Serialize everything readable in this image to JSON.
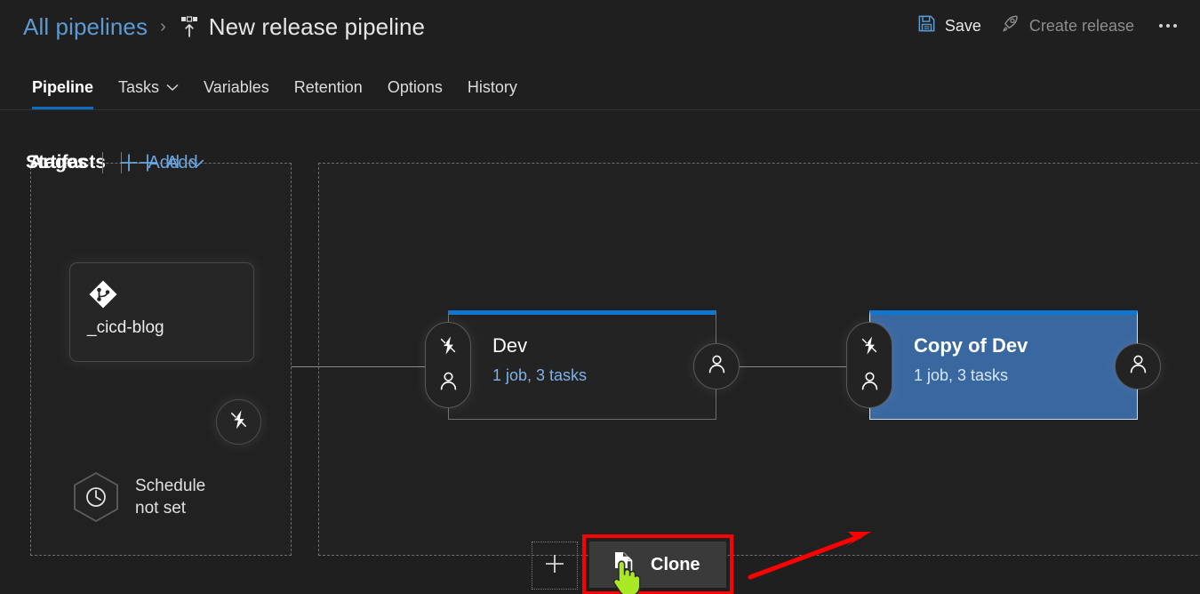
{
  "header": {
    "breadcrumb_root": "All pipelines",
    "breadcrumb_separator": "›",
    "breadcrumb_icon": "release-pipeline-icon",
    "title": "New release pipeline",
    "actions": [
      {
        "label": "Save",
        "icon": "save-floppy-icon",
        "enabled": true
      },
      {
        "label": "Create release",
        "icon": "rocket-icon",
        "enabled": false
      }
    ],
    "overflow_icon": "ellipsis-icon"
  },
  "tabs": [
    {
      "label": "Pipeline",
      "active": true,
      "has_chevron": false
    },
    {
      "label": "Tasks",
      "active": false,
      "has_chevron": true
    },
    {
      "label": "Variables",
      "active": false,
      "has_chevron": false
    },
    {
      "label": "Retention",
      "active": false,
      "has_chevron": false
    },
    {
      "label": "Options",
      "active": false,
      "has_chevron": false
    },
    {
      "label": "History",
      "active": false,
      "has_chevron": false
    }
  ],
  "artifacts": {
    "title": "Artifacts",
    "add_label": "Add",
    "add_icon": "plus-icon",
    "card": {
      "name": "_cicd-blog",
      "source_icon": "azure-repos-git-icon",
      "trigger_badge_icon": "lightning-bolt-icon"
    },
    "schedule": {
      "icon": "clock-hexagon-icon",
      "line1": "Schedule",
      "line2": "not set"
    }
  },
  "stages": {
    "title": "Stages",
    "add_label": "Add",
    "add_icon": "plus-icon",
    "add_chevron_icon": "chevron-down-icon",
    "add_stage_placeholder_icon": "plus-icon",
    "items": [
      {
        "name": "Dev",
        "meta": "1 job, 3 tasks",
        "selected": false,
        "pre_deployment_icons": [
          "lightning-bolt-icon",
          "person-icon"
        ],
        "post_deployment_icon": "person-icon"
      },
      {
        "name": "Copy of Dev",
        "meta": "1 job, 3 tasks",
        "selected": true,
        "pre_deployment_icons": [
          "lightning-bolt-icon",
          "person-icon"
        ],
        "post_deployment_icon": "person-icon"
      }
    ]
  },
  "context_menu": {
    "clone_label": "Clone",
    "clone_icon": "copy-pages-icon",
    "cursor_icon": "pointing-hand-cursor"
  },
  "annotations": {
    "highlight_color": "#ff0000",
    "arrow_color": "#ff0000",
    "cursor_color": "#a8e825"
  },
  "colors": {
    "accent_blue": "#0f6cbd",
    "link_blue": "#5b9bd5",
    "selected_stage_blue": "#39679f",
    "stage_top_border": "#0f77d1",
    "background": "#1f1f1f"
  }
}
